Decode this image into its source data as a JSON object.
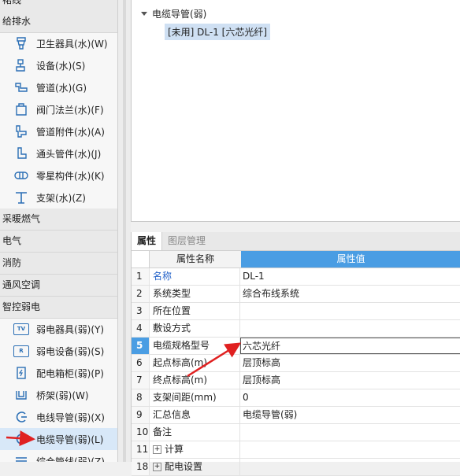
{
  "sidebar": {
    "top_partial": "裙线",
    "cat_plumbing": "给排水",
    "plumbing_items": [
      {
        "label": "卫生器具(水)(W)",
        "icon": "sanitary-icon"
      },
      {
        "label": "设备(水)(S)",
        "icon": "equipment-icon"
      },
      {
        "label": "管道(水)(G)",
        "icon": "pipe-icon"
      },
      {
        "label": "阀门法兰(水)(F)",
        "icon": "valve-icon"
      },
      {
        "label": "管道附件(水)(A)",
        "icon": "pipe-fitting-icon"
      },
      {
        "label": "通头管件(水)(J)",
        "icon": "tee-fitting-icon"
      },
      {
        "label": "零星构件(水)(K)",
        "icon": "misc-component-icon"
      },
      {
        "label": "支架(水)(Z)",
        "icon": "support-icon"
      }
    ],
    "cat_hvac_heating": "采暖燃气",
    "cat_electrical": "电气",
    "cat_fire": "消防",
    "cat_ventilation": "通风空调",
    "cat_weak_current": "智控弱电",
    "weak_items": [
      {
        "label": "弱电器具(弱)(Y)",
        "icon": "tv-icon",
        "badge": "TV"
      },
      {
        "label": "弱电设备(弱)(S)",
        "icon": "device-icon",
        "badge": "R"
      },
      {
        "label": "配电箱柜(弱)(P)",
        "icon": "cabinet-icon"
      },
      {
        "label": "桥架(弱)(W)",
        "icon": "bridge-icon"
      },
      {
        "label": "电线导管(弱)(X)",
        "icon": "wire-conduit-icon"
      },
      {
        "label": "电缆导管(弱)(L)",
        "icon": "cable-conduit-icon"
      },
      {
        "label": "综合管线(弱)(Z)",
        "icon": "pipeline-icon"
      }
    ]
  },
  "tree": {
    "root_label": "电缆导管(弱)",
    "child_label": "[未用] DL-1 [六芯光纤]"
  },
  "props": {
    "tabs": [
      "属性",
      "图层管理"
    ],
    "header_name": "属性名称",
    "header_value": "属性值",
    "rows": [
      {
        "num": "1",
        "name": "名称",
        "value": "DL-1"
      },
      {
        "num": "2",
        "name": "系统类型",
        "value": "综合布线系统"
      },
      {
        "num": "3",
        "name": "所在位置",
        "value": ""
      },
      {
        "num": "4",
        "name": "敷设方式",
        "value": ""
      },
      {
        "num": "5",
        "name": "电缆规格型号",
        "value": "六芯光纤"
      },
      {
        "num": "6",
        "name": "起点标高(m)",
        "value": "层顶标高"
      },
      {
        "num": "7",
        "name": "终点标高(m)",
        "value": "层顶标高"
      },
      {
        "num": "8",
        "name": "支架间距(mm)",
        "value": "0"
      },
      {
        "num": "9",
        "name": "汇总信息",
        "value": "电缆导管(弱)"
      },
      {
        "num": "10",
        "name": "备注",
        "value": ""
      },
      {
        "num": "11",
        "name": "计算",
        "value": ""
      },
      {
        "num": "18",
        "name": "配电设置",
        "value": ""
      }
    ]
  },
  "colors": {
    "accent": "#4a9de3",
    "arrow": "#e02020",
    "selection": "#d8e8f8"
  }
}
